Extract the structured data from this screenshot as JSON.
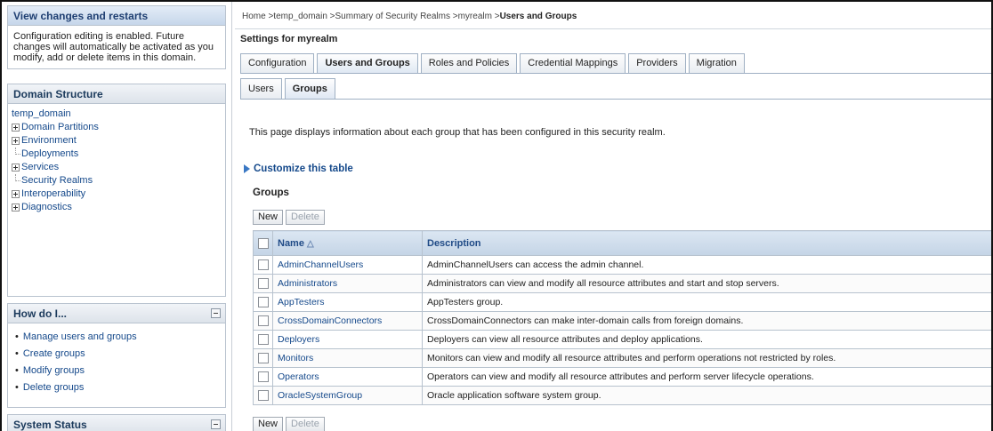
{
  "left": {
    "changes": {
      "title": "View changes and restarts",
      "body": "Configuration editing is enabled. Future changes will automatically be activated as you modify, add or delete items in this domain."
    },
    "domain_structure": {
      "title": "Domain Structure",
      "root": "temp_domain",
      "nodes": [
        {
          "label": "Domain Partitions",
          "expandable": true
        },
        {
          "label": "Environment",
          "expandable": true
        },
        {
          "label": "Deployments",
          "expandable": false
        },
        {
          "label": "Services",
          "expandable": true
        },
        {
          "label": "Security Realms",
          "expandable": false
        },
        {
          "label": "Interoperability",
          "expandable": true
        },
        {
          "label": "Diagnostics",
          "expandable": true
        }
      ]
    },
    "how_do_i": {
      "title": "How do I...",
      "items": [
        "Manage users and groups",
        "Create groups",
        "Modify groups",
        "Delete groups"
      ]
    },
    "system_status": {
      "title": "System Status"
    }
  },
  "breadcrumb": {
    "trail": "Home >temp_domain >Summary of Security Realms >myrealm >",
    "current": "Users and Groups"
  },
  "settings_title": "Settings for myrealm",
  "tabs": [
    {
      "label": "Configuration",
      "active": false
    },
    {
      "label": "Users and Groups",
      "active": true
    },
    {
      "label": "Roles and Policies",
      "active": false
    },
    {
      "label": "Credential Mappings",
      "active": false
    },
    {
      "label": "Providers",
      "active": false
    },
    {
      "label": "Migration",
      "active": false
    }
  ],
  "subtabs": [
    {
      "label": "Users",
      "active": false
    },
    {
      "label": "Groups",
      "active": true
    }
  ],
  "intro": "This page displays information about each group that has been configured in this security realm.",
  "customize_link": "Customize this table",
  "groups_label": "Groups",
  "buttons": {
    "new": "New",
    "delete": "Delete"
  },
  "table": {
    "headers": {
      "name": "Name",
      "description": "Description"
    },
    "rows": [
      {
        "name": "AdminChannelUsers",
        "description": "AdminChannelUsers can access the admin channel."
      },
      {
        "name": "Administrators",
        "description": "Administrators can view and modify all resource attributes and start and stop servers."
      },
      {
        "name": "AppTesters",
        "description": "AppTesters group."
      },
      {
        "name": "CrossDomainConnectors",
        "description": "CrossDomainConnectors can make inter-domain calls from foreign domains."
      },
      {
        "name": "Deployers",
        "description": "Deployers can view all resource attributes and deploy applications."
      },
      {
        "name": "Monitors",
        "description": "Monitors can view and modify all resource attributes and perform operations not restricted by roles."
      },
      {
        "name": "Operators",
        "description": "Operators can view and modify all resource attributes and perform server lifecycle operations."
      },
      {
        "name": "OracleSystemGroup",
        "description": "Oracle application software system group."
      }
    ]
  }
}
